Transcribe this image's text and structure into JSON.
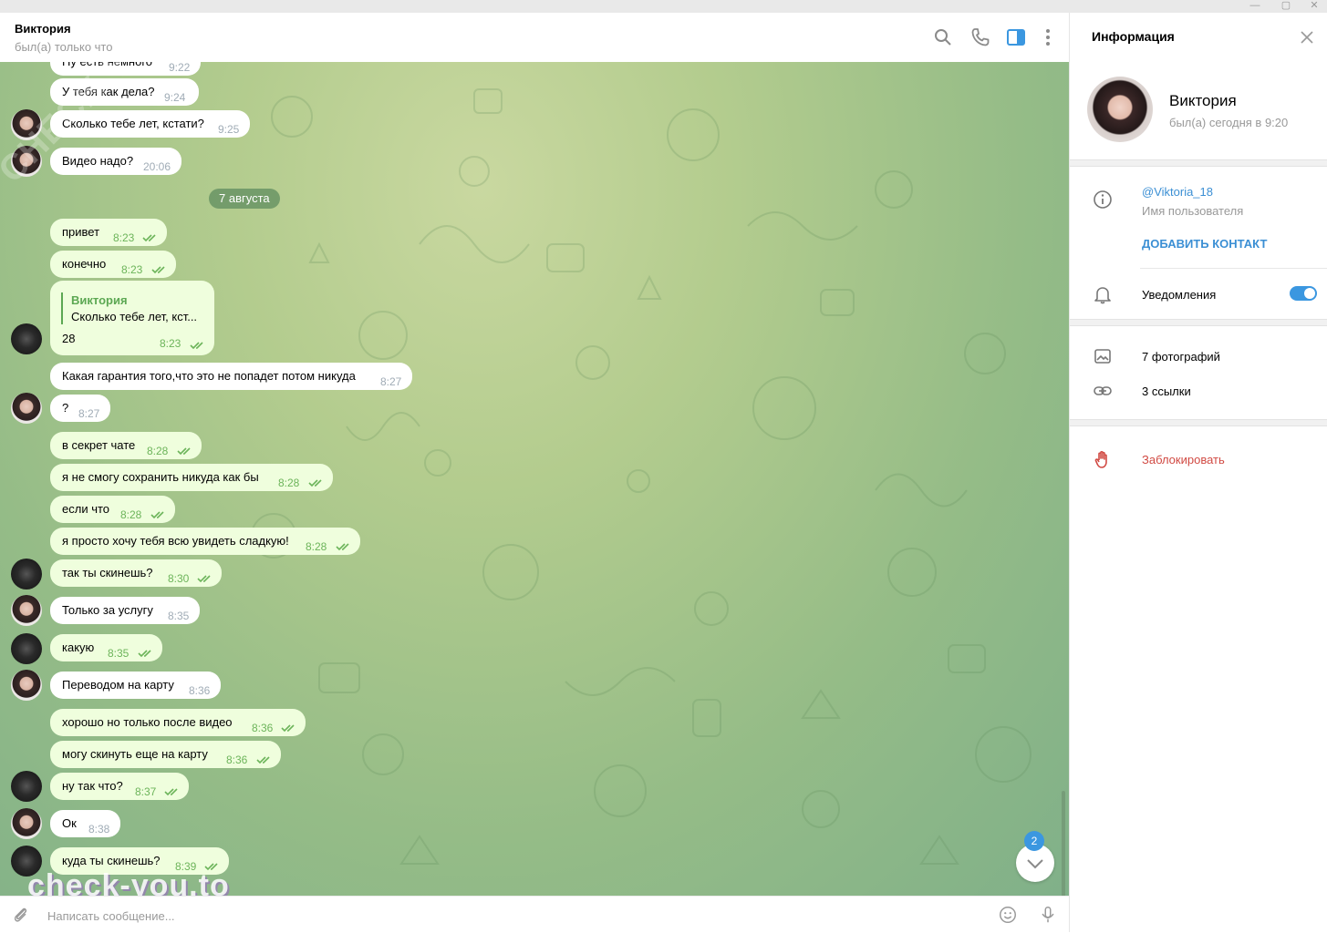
{
  "window": {
    "minimize": "—",
    "maximize": "▢",
    "close": "✕"
  },
  "header": {
    "name": "Виктория",
    "status": "был(а) только что"
  },
  "chat": {
    "date_divider": "7 августа",
    "messages": [
      {
        "text": "Ну есть немного",
        "time": "9:22",
        "dir": "in"
      },
      {
        "text": "У тебя как дела?",
        "time": "9:24",
        "dir": "in"
      },
      {
        "text": "Сколько тебе лет, кстати?",
        "time": "9:25",
        "dir": "in"
      },
      {
        "text": "Видео надо?",
        "time": "20:06",
        "dir": "in"
      },
      {
        "text": "привет",
        "time": "8:23",
        "dir": "out"
      },
      {
        "text": "конечно",
        "time": "8:23",
        "dir": "out"
      },
      {
        "text": "Какая гарантия того,что это не попадет потом никуда",
        "time": "8:27",
        "dir": "in"
      },
      {
        "text": "?",
        "time": "8:27",
        "dir": "in"
      },
      {
        "text": "в секрет чате",
        "time": "8:28",
        "dir": "out"
      },
      {
        "text": "я не смогу сохранить никуда как бы",
        "time": "8:28",
        "dir": "out"
      },
      {
        "text": "если что",
        "time": "8:28",
        "dir": "out"
      },
      {
        "text": "я просто хочу тебя всю увидеть сладкую!",
        "time": "8:28",
        "dir": "out"
      },
      {
        "text": "так ты скинешь?",
        "time": "8:30",
        "dir": "out"
      },
      {
        "text": "Только за услугу",
        "time": "8:35",
        "dir": "in"
      },
      {
        "text": "какую",
        "time": "8:35",
        "dir": "out"
      },
      {
        "text": "Переводом на карту",
        "time": "8:36",
        "dir": "in"
      },
      {
        "text": "хорошо но только после видео",
        "time": "8:36",
        "dir": "out"
      },
      {
        "text": "могу скинуть еще на карту",
        "time": "8:36",
        "dir": "out"
      },
      {
        "text": "ну так что?",
        "time": "8:37",
        "dir": "out"
      },
      {
        "text": "Ок",
        "time": "8:38",
        "dir": "in"
      },
      {
        "text": "куда ты скинешь?",
        "time": "8:39",
        "dir": "out"
      }
    ],
    "reply_message": {
      "quoted_name": "Виктория",
      "quoted_text": "Сколько тебе лет, кст...",
      "text": "28",
      "time": "8:23"
    },
    "unread_count": "2"
  },
  "watermarks": {
    "bottom": "check-you.to",
    "diagonal": "CHECK YOU ME"
  },
  "composer": {
    "placeholder": "Написать сообщение..."
  },
  "panel": {
    "title": "Информация",
    "name": "Виктория",
    "status": "был(а) сегодня в 9:20",
    "username": "@Viktoria_18",
    "username_label": "Имя пользователя",
    "add_contact": "ДОБАВИТЬ КОНТАКТ",
    "notifications": "Уведомления",
    "notifications_on": true,
    "photos": "7 фотографий",
    "links": "3 ссылки",
    "block": "Заблокировать"
  },
  "colors": {
    "accent": "#3b97e0",
    "out_bubble": "#effedd",
    "check": "#6cb45a",
    "danger": "#d14a43"
  }
}
